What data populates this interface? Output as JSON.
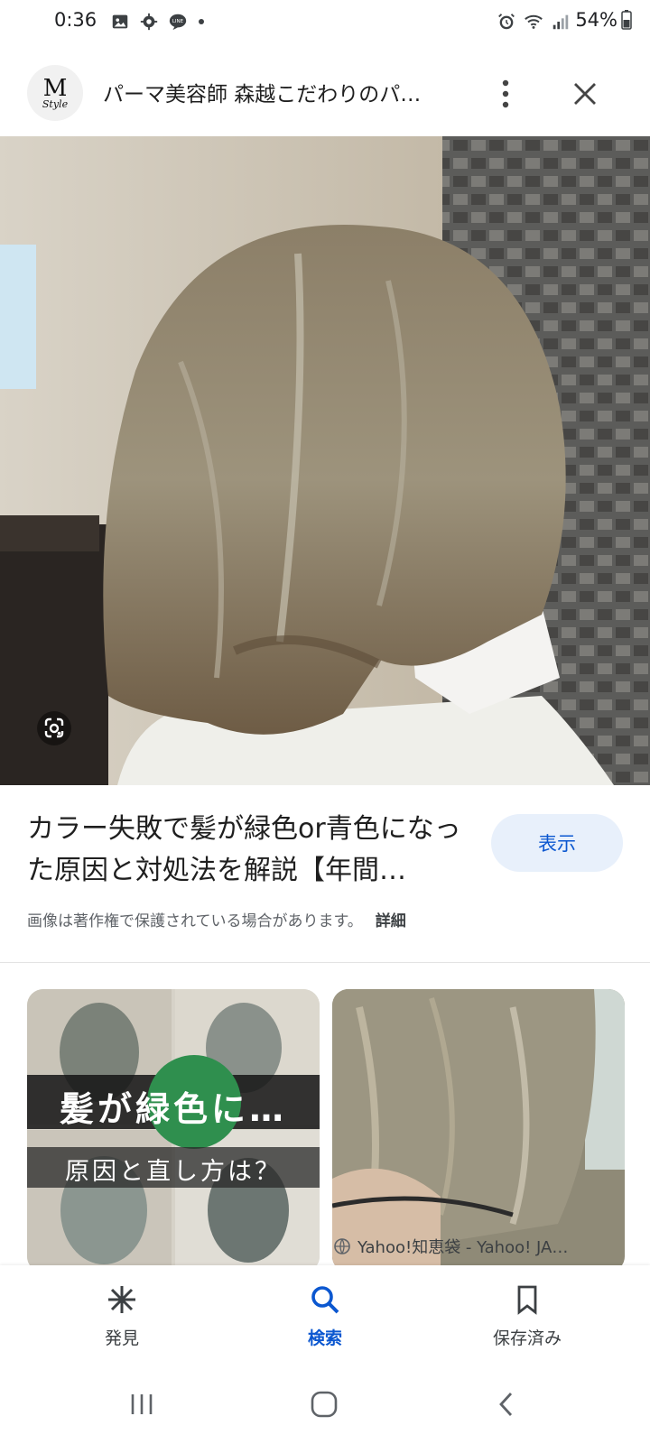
{
  "status_bar": {
    "time": "0:36",
    "battery": "54%",
    "icons_left": [
      "gallery-icon",
      "settings-gear-icon",
      "line-app-icon",
      "notification-dot-icon"
    ],
    "icons_right": [
      "alarm-icon",
      "wifi-icon",
      "signal-icon",
      "battery-icon"
    ]
  },
  "header": {
    "logo_text": "M",
    "logo_subtext": "Style",
    "title": "パーマ美容師 森越こだわりのパ…",
    "more_icon": "more-vert-icon",
    "close_icon": "close-icon"
  },
  "main_image": {
    "description_icon": "google-lens-icon"
  },
  "result": {
    "title": "カラー失敗で髪が緑色or青色になった原因と対処法を解説【年間…",
    "visit_label": "表示",
    "copyright_notice": "画像は著作権で保護されている場合があります。",
    "details_link": "詳細"
  },
  "related": {
    "left_thumb_overlay_line1": "髪が緑色に…",
    "left_thumb_overlay_line2": "原因と直し方は？",
    "right_thumb_source": "Yahoo!知恵袋 - Yahoo! JA…"
  },
  "bottom_nav": {
    "items": [
      {
        "label": "発見",
        "icon": "discover-asterisk-icon",
        "active": false
      },
      {
        "label": "検索",
        "icon": "search-icon",
        "active": true
      },
      {
        "label": "保存済み",
        "icon": "saved-bookmark-icon",
        "active": false
      }
    ]
  },
  "colors": {
    "accent": "#0b57d0",
    "visit_button_bg": "#e8f0fb",
    "muted_text": "#5f6368"
  }
}
